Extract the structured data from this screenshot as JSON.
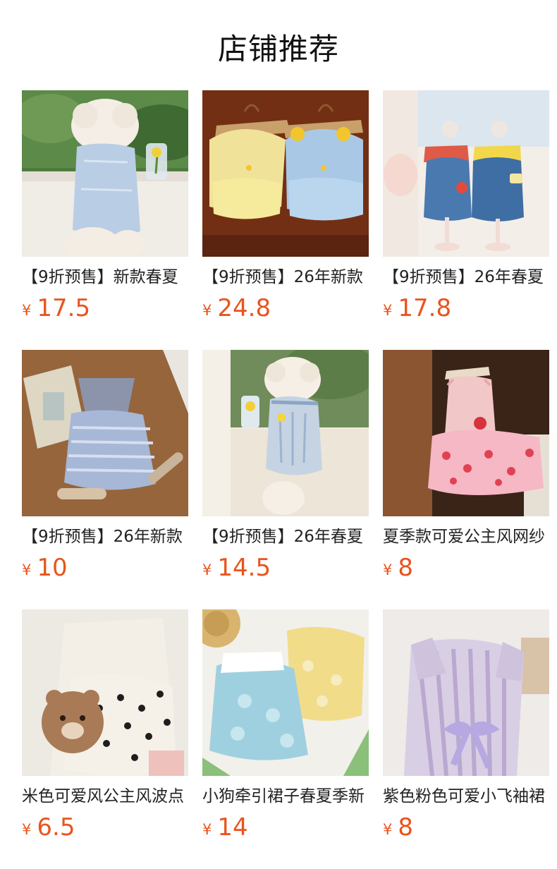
{
  "page": {
    "title": "店铺推荐"
  },
  "products": [
    {
      "name": "【9折预售】新款春夏",
      "currency": "¥",
      "price": "17.5"
    },
    {
      "name": "【9折预售】26年新款",
      "currency": "¥",
      "price": "24.8"
    },
    {
      "name": "【9折预售】26年春夏",
      "currency": "¥",
      "price": "17.8"
    },
    {
      "name": "【9折预售】26年新款",
      "currency": "¥",
      "price": "10"
    },
    {
      "name": "【9折预售】26年春夏",
      "currency": "¥",
      "price": "14.5"
    },
    {
      "name": "夏季款可爱公主风网纱",
      "currency": "¥",
      "price": "8"
    },
    {
      "name": "米色可爱风公主风波点",
      "currency": "¥",
      "price": "6.5"
    },
    {
      "name": "小狗牵引裙子春夏季新",
      "currency": "¥",
      "price": "14"
    },
    {
      "name": "紫色粉色可爱小飞袖裙",
      "currency": "¥",
      "price": "8"
    }
  ],
  "colors": {
    "price": "#e9541c",
    "title": "#111111"
  }
}
